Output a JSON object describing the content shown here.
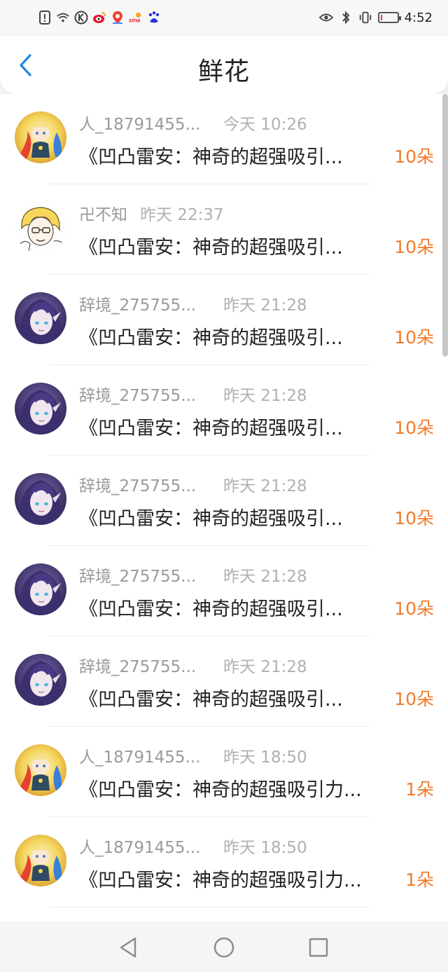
{
  "status_bar": {
    "time": "4:52",
    "icons_left": [
      "alert-icon",
      "wifi-icon",
      "k-app-icon",
      "weibo-icon",
      "map-icon",
      "sina-icon",
      "baidu-icon"
    ],
    "icons_right": [
      "eye-icon",
      "bluetooth-icon",
      "vibrate-icon",
      "battery-icon"
    ],
    "battery_level": 0.08
  },
  "header": {
    "title": "鲜花"
  },
  "items": [
    {
      "name": "人_18791455...",
      "time": "今天 10:26",
      "message": "《凹凸雷安：神奇的超强吸引...",
      "count": "10朵",
      "avatar": "blonde"
    },
    {
      "name": "卍不知",
      "time": "昨天 22:37",
      "message": "《凹凸雷安：神奇的超强吸引...",
      "count": "10朵",
      "avatar": "sketch"
    },
    {
      "name": "辞境_275755...",
      "time": "昨天 21:28",
      "message": "《凹凸雷安：神奇的超强吸引...",
      "count": "10朵",
      "avatar": "purple"
    },
    {
      "name": "辞境_275755...",
      "time": "昨天 21:28",
      "message": "《凹凸雷安：神奇的超强吸引...",
      "count": "10朵",
      "avatar": "purple"
    },
    {
      "name": "辞境_275755...",
      "time": "昨天 21:28",
      "message": "《凹凸雷安：神奇的超强吸引...",
      "count": "10朵",
      "avatar": "purple"
    },
    {
      "name": "辞境_275755...",
      "time": "昨天 21:28",
      "message": "《凹凸雷安：神奇的超强吸引...",
      "count": "10朵",
      "avatar": "purple"
    },
    {
      "name": "辞境_275755...",
      "time": "昨天 21:28",
      "message": "《凹凸雷安：神奇的超强吸引...",
      "count": "10朵",
      "avatar": "purple"
    },
    {
      "name": "人_18791455...",
      "time": "昨天 18:50",
      "message": "《凹凸雷安：神奇的超强吸引力...",
      "count": "1朵",
      "avatar": "blonde"
    },
    {
      "name": "人_18791455...",
      "time": "昨天 18:50",
      "message": "《凹凸雷安：神奇的超强吸引力...",
      "count": "1朵",
      "avatar": "blonde"
    }
  ],
  "nav": {
    "icons": [
      "back-triangle-icon",
      "home-circle-icon",
      "recent-square-icon"
    ]
  },
  "colors": {
    "accent": "#1e88e5",
    "count": "#f07b2c",
    "username": "#9a9a9a"
  }
}
